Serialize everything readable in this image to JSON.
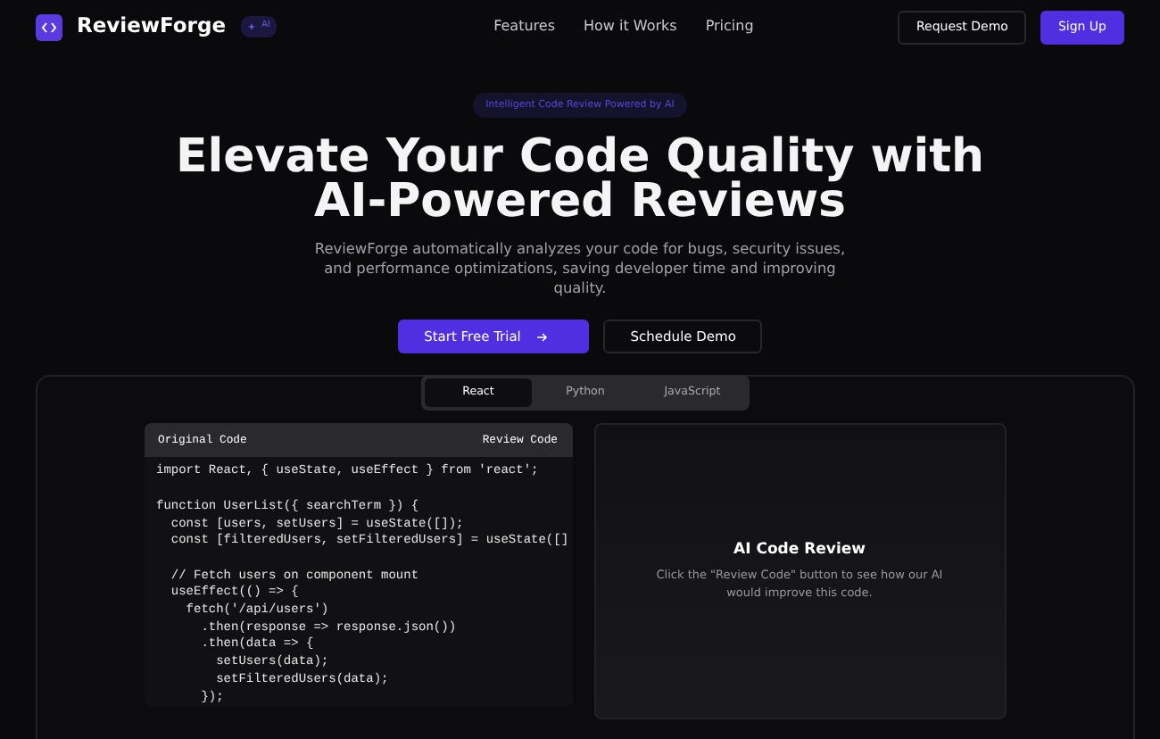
{
  "brand": {
    "name": "ReviewForge",
    "badge": "AI"
  },
  "nav": {
    "links": [
      "Features",
      "How it Works",
      "Pricing"
    ],
    "buttons": [
      {
        "label": "Request Demo",
        "kind": "outline"
      },
      {
        "label": "Sign Up",
        "kind": "primary"
      }
    ]
  },
  "hero": {
    "tag": "Intelligent Code Review Powered by AI",
    "title_line_1": "Elevate Your Code Quality with",
    "title_line_2": "AI-Powered Reviews",
    "description": "ReviewForge automatically analyzes your code for bugs, security issues, and performance optimizations, saving developer time and improving quality.",
    "buttons": [
      {
        "label": "Start Free Trial",
        "kind": "primary"
      },
      {
        "label": "Schedule Demo",
        "kind": "outline"
      }
    ]
  },
  "demo": {
    "tabs": [
      {
        "label": "React",
        "selected": true
      },
      {
        "label": "Python",
        "selected": false
      },
      {
        "label": "JavaScript",
        "selected": false
      }
    ],
    "code_card": {
      "title": "Original Code",
      "button": "Review Code",
      "blocks": [
        [
          "import React, { useState, useEffect } from 'react';"
        ],
        [
          "function UserList({ searchTerm }) {",
          "  const [users, setUsers] = useState([]);",
          "  const [filteredUsers, setFilteredUsers] = useState([]"
        ],
        [
          "  // Fetch users on component mount",
          "  useEffect(() => {",
          "    fetch('/api/users')",
          "      .then(response => response.json())",
          "      .then(data => {",
          "        setUsers(data);",
          "        setFilteredUsers(data);",
          "      });"
        ]
      ]
    },
    "review_panel": {
      "title": "AI Code Review",
      "text": "Click the \"Review Code\" button to see how our AI would improve this code."
    }
  }
}
